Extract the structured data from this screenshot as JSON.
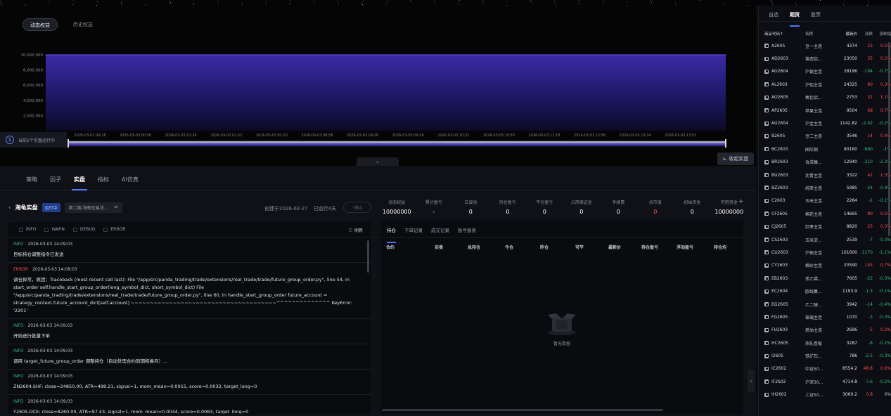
{
  "chart_tabs": {
    "dynamic": "动态权益",
    "history": "历史权益"
  },
  "chart_data": {
    "type": "area",
    "series": [
      {
        "values": [
          10000000,
          10000000,
          10000000,
          10000000,
          10000000,
          10000000,
          10000000,
          10000000,
          10000000,
          10000000,
          10000000,
          10000000,
          10000000,
          10000000
        ]
      }
    ],
    "x": [
      "2026-03-03 00:28",
      "2026-03-03 00:56",
      "2026-03-03 01:24",
      "2026-03-03 01:52",
      "2026-03-03 02:20",
      "2026-03-03 08:58",
      "2026-03-03 09:26",
      "2026-03-03 09:54",
      "2026-03-03 10:22",
      "2026-03-03 10:50",
      "2026-03-03 11:18",
      "2026-03-03 12:56",
      "2026-03-03 13:24",
      "2026-03-03 13:52"
    ],
    "yticks": [
      "10,000,000",
      "8,000,000",
      "6,000,000",
      "4,000,000",
      "2,000,000"
    ],
    "ylim": [
      0,
      10000000
    ],
    "grid": true
  },
  "run_badge": {
    "number": "1",
    "label": "当前1个实盘运行中"
  },
  "collapse_live": "收起实盘",
  "main_tabs": [
    "策略",
    "因子",
    "实盘",
    "指标",
    "AI仿真"
  ],
  "strategy": {
    "name": "海龟实盘",
    "status": "运行中",
    "account": "第二期-海龟交易法...",
    "created": "创建于2026-02-27",
    "running": "已运行4天",
    "stop": "停止"
  },
  "stats": [
    {
      "label": "动态权益",
      "value": "10000000"
    },
    {
      "label": "累计盈亏",
      "value": "-"
    },
    {
      "label": "日波动",
      "value": "0"
    },
    {
      "label": "持仓盈亏",
      "value": "0"
    },
    {
      "label": "平仓盈亏",
      "value": "0"
    },
    {
      "label": "占用保证金",
      "value": "0"
    },
    {
      "label": "手续费",
      "value": "0"
    },
    {
      "label": "总市值",
      "value": "0"
    },
    {
      "label": "初始资金",
      "value": "0"
    },
    {
      "label": "可用资金",
      "value": "10000000"
    }
  ],
  "log_filters": [
    "INFO",
    "WARN",
    "DEBUG",
    "ERROR"
  ],
  "refresh": "刷新",
  "logs": [
    {
      "level": "INFO",
      "time": "2026-03-03 14:09:03",
      "msg": "目标持仓调整指令已发送"
    },
    {
      "level": "ERROR",
      "time": "2026-03-03 14:09:03",
      "msg": "调仓异常，原因：Traceback (most recent call last): File \"/app/src/panda_trading/trade/extensions/real_trade/trade/future_group_order.py\", line 54, in start_order self.handle_start_group_order(long_symbol_dict, short_symbol_dict) File \"/app/src/panda_trading/trade/extensions/real_trade/trade/future_group_order.py\", line 60, in handle_start_group_order future_account = strategy_context.future_account_dict[self.account] ~~~~~~~~~~~~~~~~~~~~~~~~~~~~~~~~~~~~~~^^^^^^^^^^^^^^ KeyError: '2201'"
    },
    {
      "level": "INFO",
      "time": "2026-03-03 14:09:03",
      "msg": "开始进行批量下单"
    },
    {
      "level": "INFO",
      "time": "2026-03-03 14:09:03",
      "msg": "调用 target_future_group_order 调整持仓（自动处理合约到期和换月）..."
    },
    {
      "level": "INFO",
      "time": "2026-03-03 14:09:03",
      "msg": "ZN2604.SHF: close=24850.00, ATR=498.21, signal=1, mom_mean=0.0015, score=0.0032, target_long=0"
    },
    {
      "level": "INFO",
      "time": "2026-03-03 14:09:03",
      "msg": "Y2605.DCE: close=8260.00, ATR=97.43, signal=1, mom_mean=0.0044, score=0.0063, target_long=0"
    }
  ],
  "pos_tabs": [
    "持仓",
    "下单记录",
    "成交记录",
    "账号报表"
  ],
  "pos_columns": [
    "合约",
    "买卖",
    "总持仓",
    "今仓",
    "昨仓",
    "可平",
    "最新价",
    "持仓盈亏",
    "浮动盈亏",
    "持仓均"
  ],
  "empty_text": "暂无数据",
  "watch_tabs": [
    "自选",
    "期货",
    "股票"
  ],
  "watch_columns": [
    "商品代码↑",
    "名称",
    "最新价",
    "涨跌",
    "涨跌幅"
  ],
  "watch_rows": [
    {
      "code": "A2605",
      "name": "豆一主连",
      "price": "4374",
      "chg": "23",
      "pct": "0.5%",
      "dir": "up"
    },
    {
      "code": "AD2603",
      "name": "铸造铝...",
      "price": "23050",
      "chg": "35",
      "pct": "0.2%",
      "dir": "up"
    },
    {
      "code": "AG2604",
      "name": "沪银主连",
      "price": "28196",
      "chg": "-194",
      "pct": "-0.7%",
      "dir": "down"
    },
    {
      "code": "AL2603",
      "name": "沪铝主连",
      "price": "24325",
      "chg": "80",
      "pct": "0.3%",
      "dir": "up"
    },
    {
      "code": "AO2605",
      "name": "氧化铝...",
      "price": "2753",
      "chg": "31",
      "pct": "1.1%",
      "dir": "up"
    },
    {
      "code": "AP2605",
      "name": "苹果主连",
      "price": "9504",
      "chg": "68",
      "pct": "0.7%",
      "dir": "up"
    },
    {
      "code": "AU2604",
      "name": "沪金主连",
      "price": "1142.82",
      "chg": "-2.42",
      "pct": "-0.2%",
      "dir": "down"
    },
    {
      "code": "B2605",
      "name": "豆二主连",
      "price": "3546",
      "chg": "14",
      "pct": "0.4%",
      "dir": "up"
    },
    {
      "code": "BC2603",
      "name": "国际铜",
      "price": "90160",
      "chg": "-880",
      "pct": "-1%",
      "dir": "down"
    },
    {
      "code": "BR2603",
      "name": "合成橡...",
      "price": "12940",
      "chg": "-310",
      "pct": "-2.3%",
      "dir": "down"
    },
    {
      "code": "BU2603",
      "name": "沥青主连",
      "price": "3322",
      "chg": "42",
      "pct": "1.3%",
      "dir": "up"
    },
    {
      "code": "BZ2603",
      "name": "纯苯主连",
      "price": "5985",
      "chg": "-24",
      "pct": "-0.4%",
      "dir": "down"
    },
    {
      "code": "C2603",
      "name": "玉米主连",
      "price": "2284",
      "chg": "-2",
      "pct": "-0.1%",
      "dir": "down"
    },
    {
      "code": "CF2605",
      "name": "棉花主连",
      "price": "14665",
      "chg": "80",
      "pct": "0.5%",
      "dir": "up"
    },
    {
      "code": "CJ2605",
      "name": "红枣主连",
      "price": "8820",
      "chg": "25",
      "pct": "0.3%",
      "dir": "up"
    },
    {
      "code": "CS2603",
      "name": "玉米淀...",
      "price": "2539",
      "chg": "-7",
      "pct": "-0.3%",
      "dir": "down"
    },
    {
      "code": "CU2603",
      "name": "沪铜主连",
      "price": "101600",
      "chg": "-1170",
      "pct": "-1.1%",
      "dir": "down"
    },
    {
      "code": "CY2603",
      "name": "棉纱主连",
      "price": "20590",
      "chg": "145",
      "pct": "0.7%",
      "dir": "up"
    },
    {
      "code": "EB2603",
      "name": "苯乙烯...",
      "price": "7605",
      "chg": "-22",
      "pct": "-0.3%",
      "dir": "down"
    },
    {
      "code": "EC2604",
      "name": "欧线集...",
      "price": "1193.9",
      "chg": "-1.3",
      "pct": "-0.1%",
      "dir": "down"
    },
    {
      "code": "EG2605",
      "name": "乙二醇...",
      "price": "3942",
      "chg": "-14",
      "pct": "-0.4%",
      "dir": "down"
    },
    {
      "code": "FG2605",
      "name": "玻璃主连",
      "price": "1070",
      "chg": "-3",
      "pct": "-0.3%",
      "dir": "down"
    },
    {
      "code": "FU2603",
      "name": "燃油主连",
      "price": "2696",
      "chg": "5",
      "pct": "0.2%",
      "dir": "up"
    },
    {
      "code": "HC2605",
      "name": "热轧卷板",
      "price": "3287",
      "chg": "-8",
      "pct": "-0.2%",
      "dir": "down"
    },
    {
      "code": "I2605",
      "name": "铁矿石...",
      "price": "786",
      "chg": "-2.5",
      "pct": "-0.3%",
      "dir": "down"
    },
    {
      "code": "IC2602",
      "name": "中证50...",
      "price": "8554.2",
      "chg": "48.8",
      "pct": "0.6%",
      "dir": "up"
    },
    {
      "code": "IF2602",
      "name": "沪深30...",
      "price": "4714.8",
      "chg": "-7.6",
      "pct": "-0.2%",
      "dir": "down"
    },
    {
      "code": "IH2602",
      "name": "上证50...",
      "price": "3060.2",
      "chg": "0.8",
      "pct": "0%",
      "dir": "up"
    }
  ]
}
